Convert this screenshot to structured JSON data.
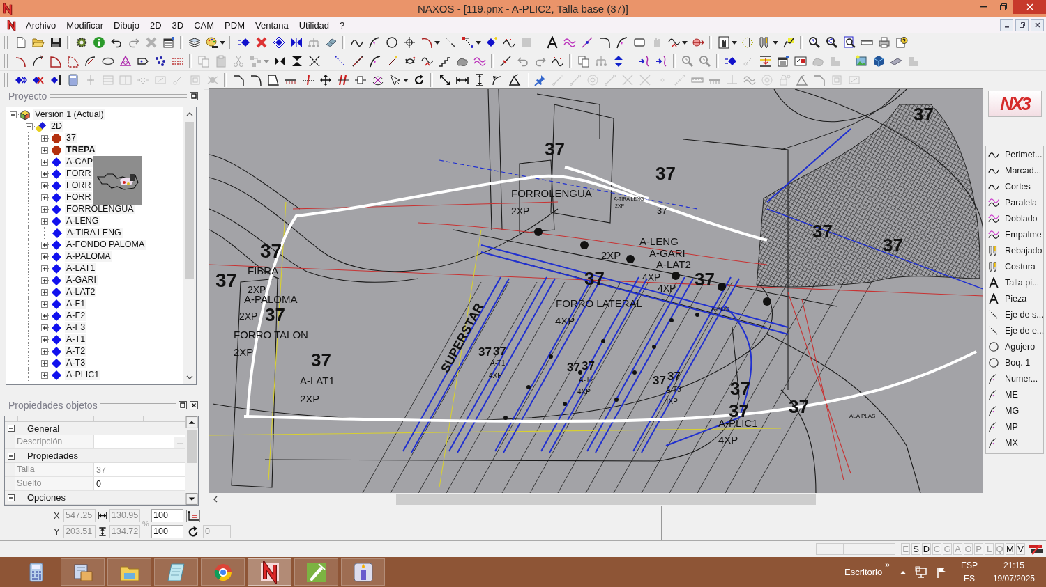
{
  "window": {
    "title": "NAXOS - [119.pnx - A-PLIC2, Talla base (37)]"
  },
  "menu": [
    "Archivo",
    "Modificar",
    "Dibujo",
    "2D",
    "3D",
    "CAM",
    "PDM",
    "Ventana",
    "Utilidad",
    "?"
  ],
  "toolbars": [
    {
      "groups": [
        [
          {
            "disabled": false
          },
          {
            "disabled": false
          },
          {
            "disabled": false
          }
        ],
        [
          {
            "disabled": false
          },
          {
            "disabled": false
          },
          {
            "disabled": false
          },
          {
            "disabled": true
          },
          {
            "disabled": true
          },
          {
            "disabled": false
          }
        ],
        [
          {
            "disabled": false
          },
          {
            "disabled": false
          },
          {
            "disabled": false
          }
        ],
        [
          {
            "disabled": false
          },
          {
            "disabled": false
          },
          {
            "disabled": false
          },
          {
            "disabled": false
          },
          {
            "disabled": true
          },
          {
            "disabled": false
          }
        ],
        [
          {
            "disabled": false
          },
          {
            "disabled": false
          },
          {
            "disabled": false
          },
          {
            "disabled": false
          },
          {
            "disabled": false
          },
          {
            "disabled": false
          },
          {
            "disabled": false
          },
          {
            "disabled": false
          },
          {
            "disabled": false
          },
          {
            "disabled": false
          },
          {
            "disabled": false
          },
          {
            "disabled": true
          }
        ],
        [
          {
            "disabled": false
          },
          {
            "disabled": false
          },
          {
            "disabled": false
          },
          {
            "disabled": false
          },
          {
            "disabled": false
          },
          {
            "disabled": false
          },
          {
            "disabled": true
          },
          {
            "disabled": false
          },
          {
            "disabled": false
          },
          {
            "disabled": false
          }
        ],
        [
          {
            "disabled": false
          },
          {
            "disabled": false
          },
          {
            "disabled": false
          },
          {
            "disabled": false
          },
          {
            "disabled": false
          },
          {
            "disabled": false
          }
        ],
        [
          {
            "disabled": false
          },
          {
            "disabled": false
          },
          {
            "disabled": false
          },
          {
            "disabled": false
          },
          {
            "disabled": false
          },
          {
            "disabled": false
          }
        ]
      ]
    },
    {
      "groups": [
        [
          {
            "disabled": false
          },
          {
            "disabled": false
          },
          {
            "disabled": false
          },
          {
            "disabled": false
          },
          {
            "disabled": false
          },
          {
            "disabled": false
          },
          {
            "disabled": false
          },
          {
            "disabled": false
          },
          {
            "disabled": false
          },
          {
            "disabled": false
          }
        ],
        [
          {
            "disabled": true
          },
          {
            "disabled": true
          },
          {
            "disabled": true
          },
          {
            "disabled": true
          },
          {
            "disabled": true
          },
          {
            "disabled": false
          },
          {
            "disabled": false
          },
          {
            "disabled": false
          }
        ],
        [
          {
            "disabled": false
          },
          {
            "disabled": false
          },
          {
            "disabled": false
          },
          {
            "disabled": false
          },
          {
            "disabled": false
          },
          {
            "disabled": false
          },
          {
            "disabled": false
          },
          {
            "disabled": false
          },
          {
            "disabled": false
          }
        ],
        [
          {
            "disabled": false
          },
          {
            "disabled": true
          },
          {
            "disabled": true
          },
          {
            "disabled": false
          }
        ],
        [
          {
            "disabled": false
          },
          {
            "disabled": true
          },
          {
            "disabled": false
          }
        ],
        [
          {
            "disabled": false
          },
          {
            "disabled": false
          }
        ],
        [
          {
            "disabled": true
          },
          {
            "disabled": true
          }
        ],
        [
          {
            "disabled": false
          },
          {
            "disabled": true
          },
          {
            "disabled": false
          },
          {
            "disabled": false
          },
          {
            "disabled": false
          },
          {
            "disabled": true
          },
          {
            "disabled": true
          }
        ],
        [
          {
            "disabled": false
          },
          {
            "disabled": false
          },
          {
            "disabled": false
          },
          {
            "disabled": true
          }
        ]
      ]
    },
    {
      "groups": [
        [
          {
            "disabled": false
          },
          {
            "disabled": false
          },
          {
            "disabled": false
          },
          {
            "disabled": false
          },
          {
            "disabled": true
          },
          {
            "disabled": true
          },
          {
            "disabled": true
          },
          {
            "disabled": true
          },
          {
            "disabled": true
          },
          {
            "disabled": true
          },
          {
            "disabled": true
          },
          {
            "disabled": true
          }
        ],
        [
          {
            "disabled": false
          },
          {
            "disabled": false
          },
          {
            "disabled": false
          },
          {
            "disabled": false
          },
          {
            "disabled": false
          },
          {
            "disabled": false
          },
          {
            "disabled": false
          },
          {
            "disabled": false
          },
          {
            "disabled": false
          },
          {
            "disabled": false
          },
          {
            "disabled": false
          },
          {
            "disabled": false
          }
        ],
        [
          {
            "disabled": false
          },
          {
            "disabled": false
          },
          {
            "disabled": false
          },
          {
            "disabled": false
          },
          {
            "disabled": false
          }
        ],
        [
          {
            "disabled": false
          },
          {
            "disabled": true
          },
          {
            "disabled": true
          },
          {
            "disabled": true
          },
          {
            "disabled": true
          },
          {
            "disabled": true
          },
          {
            "disabled": true
          },
          {
            "disabled": true
          },
          {
            "disabled": true
          },
          {
            "disabled": true
          },
          {
            "disabled": true
          },
          {
            "disabled": true
          },
          {
            "disabled": true
          },
          {
            "disabled": true
          },
          {
            "disabled": true
          },
          {
            "disabled": true
          },
          {
            "disabled": true
          },
          {
            "disabled": true
          },
          {
            "disabled": true
          }
        ]
      ]
    }
  ],
  "project_panel": {
    "title": "Proyecto",
    "hover_preview": true,
    "tree": [
      {
        "label": "Versión 1 (Actual)",
        "kind": "version",
        "expandable": true,
        "expanded": true,
        "active": false,
        "children": [
          {
            "label": "2D",
            "kind": "folder",
            "expandable": true,
            "expanded": true,
            "active": false,
            "children": [
              {
                "label": "37",
                "kind": "size",
                "expandable": true,
                "expanded": false,
                "active": false
              },
              {
                "label": "TREPA",
                "kind": "size",
                "expandable": true,
                "expanded": false,
                "active": true
              },
              {
                "label": "A-CAP",
                "kind": "piece",
                "expandable": true,
                "expanded": false,
                "active": false
              },
              {
                "label": "FORR",
                "kind": "piece",
                "expandable": true,
                "expanded": false,
                "active": false
              },
              {
                "label": "FORR",
                "kind": "piece",
                "expandable": true,
                "expanded": false,
                "active": false
              },
              {
                "label": "FORR",
                "kind": "piece",
                "expandable": true,
                "expanded": false,
                "active": false
              },
              {
                "label": "FORROLENGUA",
                "kind": "piece",
                "expandable": true,
                "expanded": false,
                "active": false
              },
              {
                "label": "A-LENG",
                "kind": "piece",
                "expandable": true,
                "expanded": false,
                "active": false
              },
              {
                "label": "A-TIRA LENG",
                "kind": "piece",
                "expandable": false,
                "expanded": false,
                "active": false
              },
              {
                "label": "A-FONDO PALOMA",
                "kind": "piece",
                "expandable": true,
                "expanded": false,
                "active": false
              },
              {
                "label": "A-PALOMA",
                "kind": "piece",
                "expandable": true,
                "expanded": false,
                "active": false
              },
              {
                "label": "A-LAT1",
                "kind": "piece",
                "expandable": true,
                "expanded": false,
                "active": false
              },
              {
                "label": "A-GARI",
                "kind": "piece",
                "expandable": true,
                "expanded": false,
                "active": false
              },
              {
                "label": "A-LAT2",
                "kind": "piece",
                "expandable": true,
                "expanded": false,
                "active": false
              },
              {
                "label": "A-F1",
                "kind": "piece",
                "expandable": true,
                "expanded": false,
                "active": false
              },
              {
                "label": "A-F2",
                "kind": "piece",
                "expandable": true,
                "expanded": false,
                "active": false
              },
              {
                "label": "A-F3",
                "kind": "piece",
                "expandable": true,
                "expanded": false,
                "active": false
              },
              {
                "label": "A-T1",
                "kind": "piece",
                "expandable": true,
                "expanded": false,
                "active": false
              },
              {
                "label": "A-T2",
                "kind": "piece",
                "expandable": true,
                "expanded": false,
                "active": false
              },
              {
                "label": "A-T3",
                "kind": "piece",
                "expandable": true,
                "expanded": false,
                "active": false
              },
              {
                "label": "A-PLIC1",
                "kind": "piece",
                "expandable": true,
                "expanded": false,
                "active": false
              }
            ]
          }
        ]
      }
    ]
  },
  "properties_panel": {
    "title": "Propiedades objetos",
    "sections": [
      {
        "label": "General",
        "expanded": true,
        "rows": [
          {
            "label": "Descripción",
            "button": "...",
            "readonly": false
          }
        ]
      },
      {
        "label": "Propiedades",
        "expanded": true,
        "rows": [
          {
            "label": "Talla",
            "value": "37",
            "readonly": true
          },
          {
            "label": "Suelto",
            "value": "0",
            "readonly": false
          }
        ]
      },
      {
        "label": "Opciones",
        "expanded": true
      }
    ]
  },
  "canvas": {
    "labels": [
      "37",
      "37",
      "37",
      "FORROLENGUA",
      "A-TIRA LENG",
      "2XP",
      "2XP",
      "37",
      "37",
      "FIBRA",
      "37",
      "2XP",
      "A-PALOMA",
      "2XP",
      "37",
      "FORRO TALON",
      "2XP",
      "37",
      "A-LAT1",
      "2XP",
      "A-LENG",
      "37",
      "37",
      "2XP",
      "A-GARI",
      "A-LAT2",
      "37",
      "4XP",
      "4XP",
      "37",
      "FORRO LATERAL",
      "A-PLIC",
      "4XP",
      "SUPERSTAR",
      "37",
      "37",
      "A-T1",
      "4XP",
      "37",
      "37",
      "A-T2",
      "4XP",
      "37",
      "37",
      "A-T3",
      "4XP",
      "37",
      "37",
      "37",
      "A-PLIC1",
      "4XP",
      "ALA PLAS"
    ]
  },
  "tool_palette": {
    "logo": "NX3",
    "items": [
      "Perimet...",
      "Marcad...",
      "Cortes",
      "Paralela",
      "Doblado",
      "Empalme",
      "Rebajado",
      "Costura",
      "Talla pi...",
      "Pieza",
      "Eje de s...",
      "Eje de e...",
      "Agujero",
      "Boq. 1",
      "Numer...",
      "ME",
      "MG",
      "MP",
      "MX"
    ]
  },
  "coordinates": {
    "x": {
      "label": "X",
      "value": "547.25",
      "disabled": true
    },
    "width": {
      "value": "130.95",
      "disabled": true
    },
    "y": {
      "label": "Y",
      "value": "203.51",
      "disabled": true
    },
    "height": {
      "value": "134.72",
      "disabled": true
    },
    "percent": "%",
    "scale_x": {
      "value": "100",
      "disabled": false
    },
    "scale_y": {
      "value": "100",
      "disabled": false
    },
    "rotation": {
      "value": "0",
      "disabled": true
    }
  },
  "status_bar": {
    "toggles": [
      {
        "label": "E",
        "on": false
      },
      {
        "label": "S",
        "on": true
      },
      {
        "label": "D",
        "on": true
      },
      {
        "label": "C",
        "on": false
      },
      {
        "label": "G",
        "on": false
      },
      {
        "label": "A",
        "on": false
      },
      {
        "label": "O",
        "on": false
      },
      {
        "label": "P",
        "on": false
      },
      {
        "label": "L",
        "on": false
      },
      {
        "label": "Q",
        "on": false
      },
      {
        "label": "M",
        "on": true
      },
      {
        "label": "V",
        "on": true
      }
    ]
  },
  "taskbar": {
    "apps": [
      {
        "running": false,
        "active": false
      },
      {
        "running": true,
        "active": false
      },
      {
        "running": true,
        "active": false
      },
      {
        "running": true,
        "active": false
      },
      {
        "running": true,
        "active": false
      },
      {
        "running": true,
        "active": true
      },
      {
        "running": true,
        "active": false
      },
      {
        "running": true,
        "active": false
      }
    ],
    "toolbar_label": "Escritorio",
    "overflow": "»",
    "language": "ESP",
    "layout": "ES",
    "time": "21:15",
    "date": "19/07/2025"
  }
}
